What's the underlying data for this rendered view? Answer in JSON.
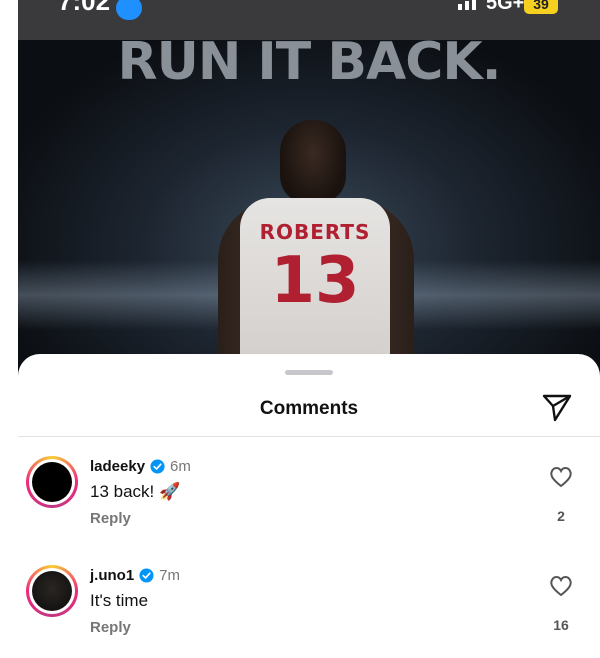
{
  "status_bar": {
    "time": "7:02",
    "network": "5G+",
    "battery": "39"
  },
  "post": {
    "headline": "RUN IT BACK.",
    "jersey_name": "ROBERTS",
    "jersey_number": "13"
  },
  "comments_sheet": {
    "title": "Comments",
    "comments": [
      {
        "username": "ladeeky",
        "time": "6m",
        "text": "13 back! 🚀",
        "reply_label": "Reply",
        "likes": "2"
      },
      {
        "username": "j.uno1",
        "time": "7m",
        "text": "It's time",
        "reply_label": "Reply",
        "likes": "16"
      }
    ]
  }
}
